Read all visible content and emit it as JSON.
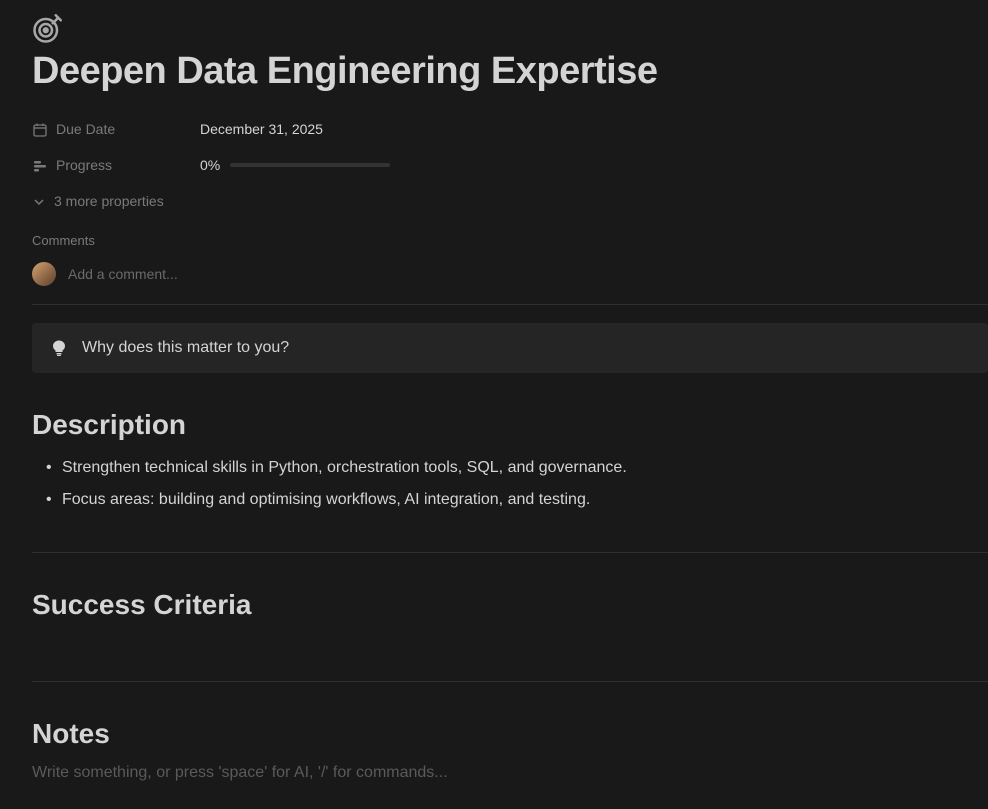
{
  "page": {
    "title": "Deepen Data Engineering Expertise"
  },
  "properties": {
    "dueDate": {
      "label": "Due Date",
      "value": "December 31, 2025"
    },
    "progress": {
      "label": "Progress",
      "value": "0%",
      "percent": 0
    },
    "moreLabel": "3 more properties"
  },
  "comments": {
    "label": "Comments",
    "placeholder": "Add a comment..."
  },
  "callout": {
    "text": "Why does this matter to you?"
  },
  "sections": {
    "description": {
      "heading": "Description",
      "bullets": [
        "Strengthen technical skills in Python, orchestration tools, SQL, and governance.",
        "Focus areas: building and optimising workflows, AI integration, and testing."
      ]
    },
    "successCriteria": {
      "heading": "Success Criteria"
    },
    "notes": {
      "heading": "Notes",
      "placeholder": "Write something, or press 'space' for AI, '/' for commands..."
    }
  }
}
